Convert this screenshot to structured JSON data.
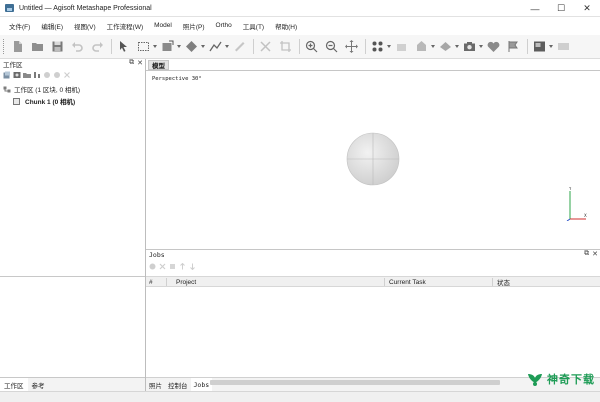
{
  "window": {
    "title": "Untitled — Agisoft Metashape Professional",
    "controls": {
      "minimize": "—",
      "maximize": "☐",
      "close": "✕"
    }
  },
  "menu": [
    "文件(F)",
    "编辑(E)",
    "视图(V)",
    "工作流程(W)",
    "Model",
    "照片(P)",
    "Ortho",
    "工具(T)",
    "帮助(H)"
  ],
  "toolbar": {
    "buttons": [
      "new-icon",
      "open-icon",
      "save-icon",
      "undo-icon",
      "redo-icon",
      "navigation-icon",
      "rectangle-selection-icon",
      "resize-region-icon",
      "rotate-region-icon",
      "draw-polyline-icon",
      "ruler-icon",
      "delete-icon",
      "crop-icon",
      "zoom-in-icon",
      "zoom-out-icon",
      "move-icon",
      "point-cloud-icon",
      "dense-cloud-icon",
      "shaded-icon",
      "model-icon",
      "camera-icon",
      "tiled-icon",
      "markers-icon",
      "ortho-icon",
      "dem-icon"
    ]
  },
  "workspace": {
    "header": "工作区",
    "tree": {
      "root": "工作区 (1 区块, 0 相机)",
      "chunk": "Chunk 1 (0 相机)"
    },
    "tabs": [
      "工作区",
      "参考"
    ],
    "active_tab": 0
  },
  "model_view": {
    "tab": "模型",
    "perspective": "Perspective 30°",
    "axis_labels": {
      "up": "Y",
      "right": "X"
    }
  },
  "jobs": {
    "header": "Jobs",
    "columns": [
      "#",
      "Project",
      "Current Task",
      "状态"
    ],
    "tabs": [
      "照片",
      "控制台",
      "Jobs"
    ],
    "active_tab": 2
  },
  "watermark": "神奇下载",
  "colors": {
    "accent": "#3f6f95",
    "watermark": "#1e9c56",
    "axis_x": "#d12c2c",
    "axis_y": "#2da44a",
    "axis_z": "#2a52c9"
  }
}
